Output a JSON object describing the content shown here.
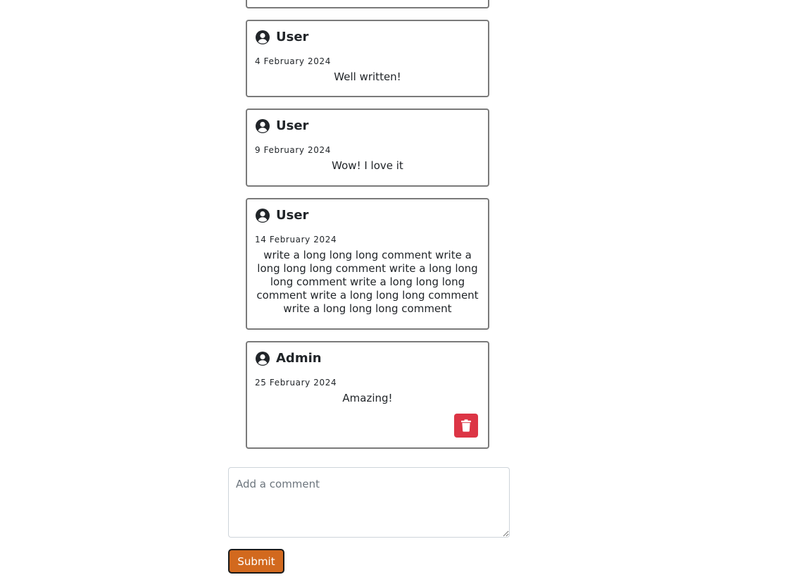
{
  "comments": [
    {
      "author": "User",
      "date": "4 February 2024",
      "text": "Well written!"
    },
    {
      "author": "User",
      "date": "9 February 2024",
      "text": "Wow! I love it"
    },
    {
      "author": "User",
      "date": "14 February 2024",
      "text": "write a long long long comment write a long long long comment write a long long long comment write a long long long comment write a long long long comment write a long long long comment"
    },
    {
      "author": "Admin",
      "date": "25 February 2024",
      "text": "Amazing!",
      "deletable": true
    }
  ],
  "form": {
    "placeholder": "Add a comment",
    "submit_label": "Submit"
  },
  "colors": {
    "delete": "#dc3545",
    "submit": "#d2691e",
    "card_border": "#7a7a7a"
  },
  "icons": {
    "avatar": "user-circle-icon",
    "delete": "trash-icon"
  }
}
